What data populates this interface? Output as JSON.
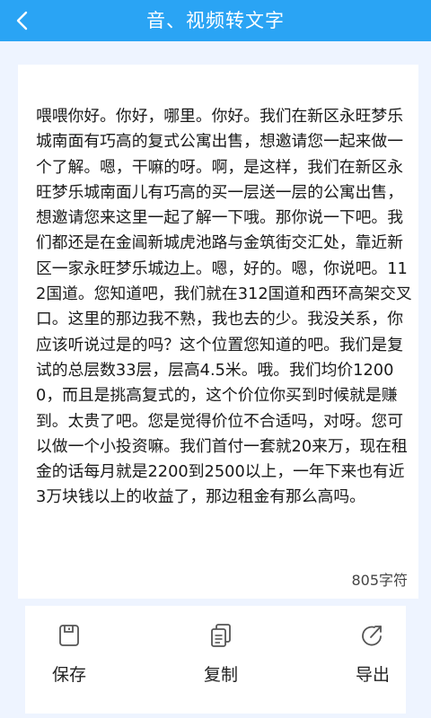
{
  "header": {
    "title": "音、视频转文字",
    "back_icon": "chevron-left-icon"
  },
  "transcript": {
    "text": "喂喂你好。你好，哪里。你好。我们在新区永旺梦乐城南面有巧高的复式公寓出售，想邀请您一起来做一个了解。嗯，干嘛的呀。啊，是这样，我们在新区永旺梦乐城南面儿有巧高的买一层送一层的公寓出售，想邀请您来这里一起了解一下哦。那你说一下吧。我们都还是在金阊新城虎池路与金筑街交汇处，靠近新区一家永旺梦乐城边上。嗯，好的。嗯，你说吧。112国道。您知道吧，我们就在312国道和西环高架交叉口。这里的那边我不熟，我也去的少。我没关系，你应该听说过是的吗？这个位置您知道的吧。我们是复试的总层数33层，层高4.5米。哦。我们均价12000，而且是挑高复式的，这个价位你买到时候就是赚到。太贵了吧。您是觉得价位不合适吗，对呀。您可以做一个小投资嘛。我们首付一套就20来万，现在租金的话每月就是2200到2500以上，一年下来也有近3万块钱以上的收益了，那边租金有那么高吗。",
    "char_count": "805字符"
  },
  "actions": [
    {
      "label": "保存",
      "icon": "save-icon"
    },
    {
      "label": "复制",
      "icon": "copy-icon"
    },
    {
      "label": "导出",
      "icon": "export-icon"
    }
  ],
  "colors": {
    "header": "#2AA4F4",
    "background": "#eef4ff",
    "icon": "#555555"
  }
}
